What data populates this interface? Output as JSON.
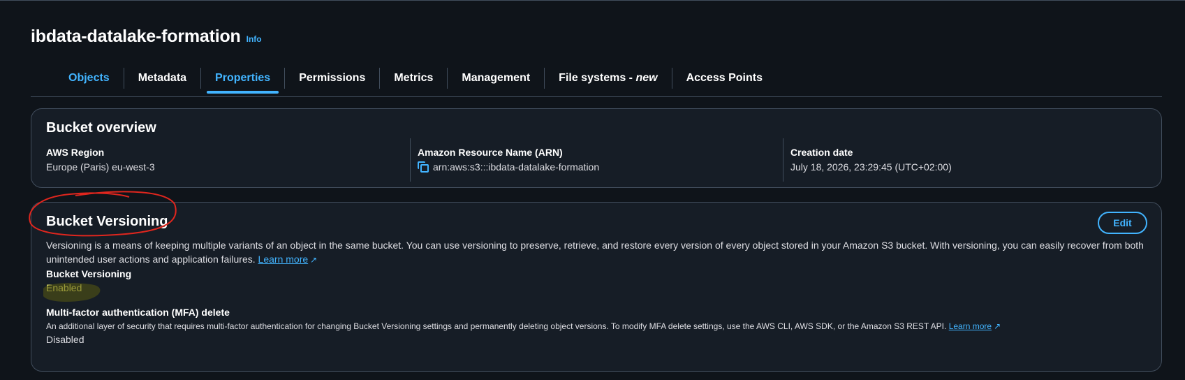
{
  "header": {
    "title": "ibdata-datalake-formation",
    "info_label": "Info"
  },
  "tabs": [
    {
      "label": "Objects"
    },
    {
      "label": "Metadata"
    },
    {
      "label": "Properties"
    },
    {
      "label": "Permissions"
    },
    {
      "label": "Metrics"
    },
    {
      "label": "Management"
    },
    {
      "label": "File systems - ",
      "suffix": "new"
    },
    {
      "label": "Access Points"
    }
  ],
  "active_tab": "Properties",
  "overview": {
    "title": "Bucket overview",
    "region_label": "AWS Region",
    "region_value": "Europe (Paris) eu-west-3",
    "arn_label": "Amazon Resource Name (ARN)",
    "arn_value": "arn:aws:s3:::ibdata-datalake-formation",
    "created_label": "Creation date",
    "created_value": "July 18, 2026, 23:29:45 (UTC+02:00)"
  },
  "versioning": {
    "title": "Bucket Versioning",
    "edit_label": "Edit",
    "description": "Versioning is a means of keeping multiple variants of an object in the same bucket. You can use versioning to preserve, retrieve, and restore every version of every object stored in your Amazon S3 bucket. With versioning, you can easily recover from both unintended user actions and application failures.",
    "learn_more": "Learn more",
    "status_label": "Bucket Versioning",
    "status_value": "Enabled",
    "mfa_label": "Multi-factor authentication (MFA) delete",
    "mfa_description": "An additional layer of security that requires multi-factor authentication for changing Bucket Versioning settings and permanently deleting object versions. To modify MFA delete settings, use the AWS CLI, AWS SDK, or the Amazon S3 REST API.",
    "mfa_learn_more": "Learn more",
    "mfa_value": "Disabled"
  },
  "colors": {
    "background": "#0f141a",
    "card": "#161d26",
    "accent": "#42b4ff",
    "annotation_red": "#e0261e",
    "highlight_yellow": "#e6e66a"
  },
  "icons": [
    "copy-icon",
    "external-link-icon"
  ]
}
